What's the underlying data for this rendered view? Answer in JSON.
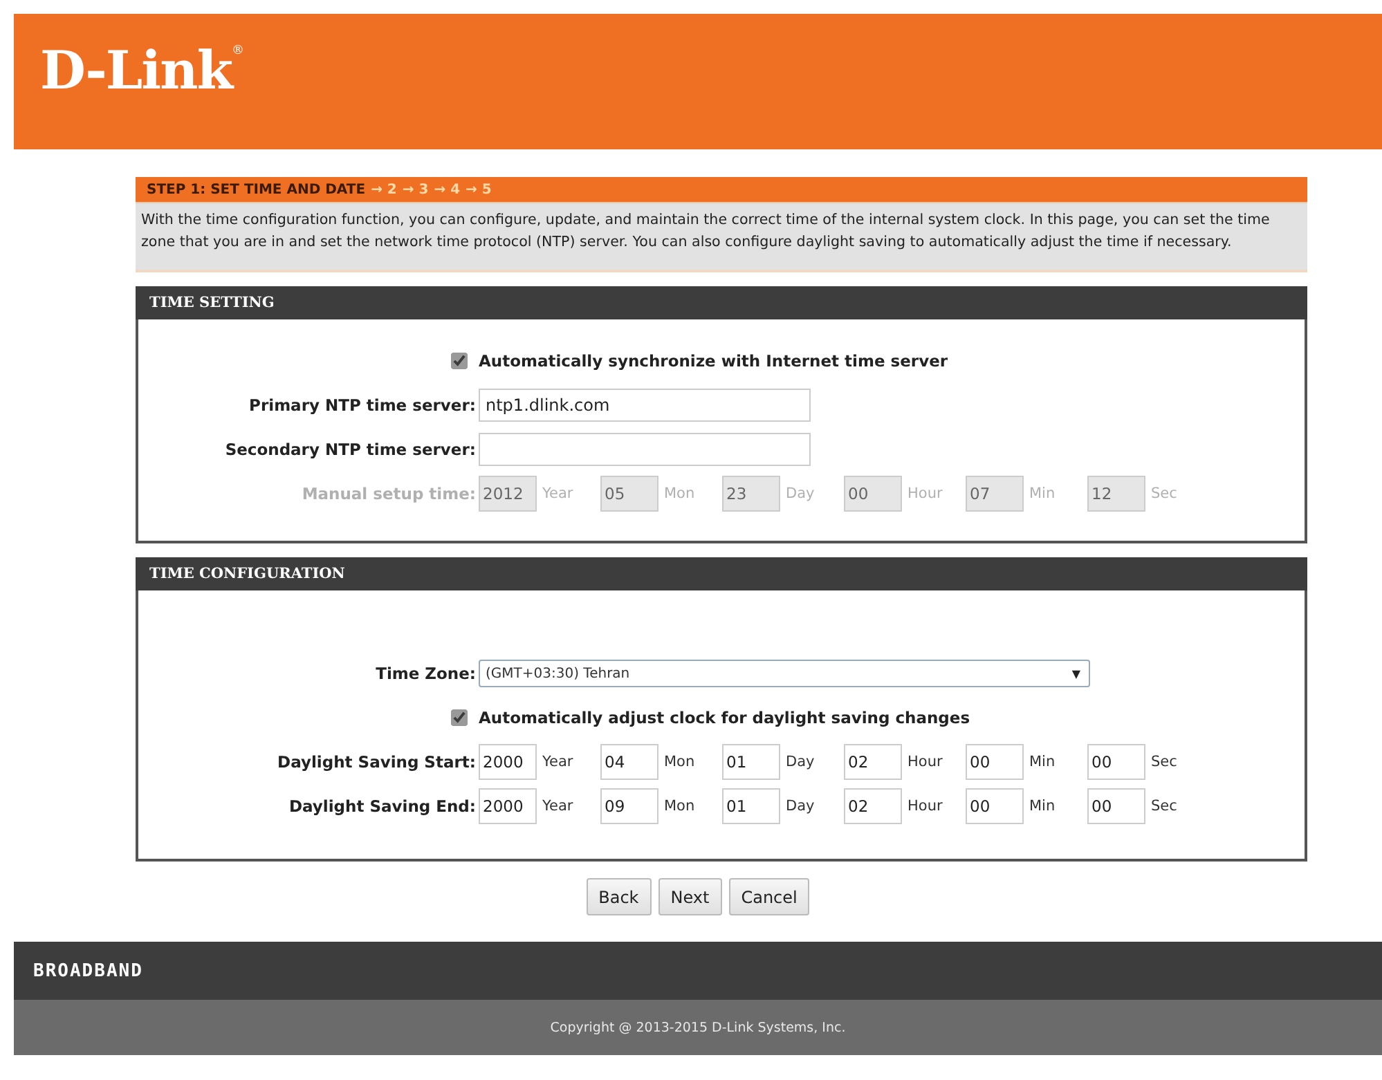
{
  "header": {
    "logo": "D-Link$^{®}$"
  },
  "wizard": {
    "title": "STEP 1: SET TIME AND DATE",
    "steps": [
      {
        "arrow": "→",
        "label": "2"
      },
      {
        "arrow": "→",
        "label": "3"
      },
      {
        "arrow": "→",
        "label": "4"
      },
      {
        "arrow": "→",
        "label": "5"
      }
    ],
    "description": "With the time configuration function, you can configure, update, and maintain the correct time of the internal system clock. In this page, you can set the time zone that you are in and set the network time protocol (NTP) server. You can also configure daylight saving to automatically adjust the time if necessary."
  },
  "sections": [
    {
      "title": "TIME SETTING",
      "rows": [
        {
          "kind": "checkbox",
          "label": "Automatically synchronize with Internet time server",
          "checked": true
        },
        {
          "kind": "text",
          "label": "Primary NTP time server:",
          "value": "ntp1.dlink.com"
        },
        {
          "kind": "text",
          "label": "Secondary NTP time server:"
        },
        {
          "kind": "datetime",
          "label": "Manual setup time:",
          "disabled": true,
          "parts": [
            {
              "value": "2012",
              "unit": "Year"
            },
            {
              "value": "05",
              "unit": "Mon"
            },
            {
              "value": "23",
              "unit": "Day"
            },
            {
              "value": "00",
              "unit": "Hour"
            },
            {
              "value": "07",
              "unit": "Min"
            },
            {
              "value": "12",
              "unit": "Sec"
            }
          ]
        }
      ]
    },
    {
      "title": "TIME CONFIGURATION",
      "rows": [
        {
          "kind": "select",
          "label": "Time Zone:",
          "value": "(GMT+03:30) Tehran",
          "arrow": "▼"
        },
        {
          "kind": "checkbox",
          "label": "Automatically adjust clock for daylight saving changes",
          "checked": true
        },
        {
          "kind": "datetime",
          "label": "Daylight Saving Start:",
          "disabled": false,
          "parts": [
            {
              "value": "2000",
              "unit": "Year"
            },
            {
              "value": "04",
              "unit": "Mon"
            },
            {
              "value": "01",
              "unit": "Day"
            },
            {
              "value": "02",
              "unit": "Hour"
            },
            {
              "value": "00",
              "unit": "Min"
            },
            {
              "value": "00",
              "unit": "Sec"
            }
          ]
        },
        {
          "kind": "datetime",
          "label": "Daylight Saving End:",
          "disabled": false,
          "parts": [
            {
              "value": "2000",
              "unit": "Year"
            },
            {
              "value": "09",
              "unit": "Mon"
            },
            {
              "value": "01",
              "unit": "Day"
            },
            {
              "value": "02",
              "unit": "Hour"
            },
            {
              "value": "00",
              "unit": "Min"
            },
            {
              "value": "00",
              "unit": "Sec"
            }
          ]
        }
      ]
    }
  ],
  "buttons": [
    "Back",
    "Next",
    "Cancel"
  ],
  "footer": {
    "brand": "BROADBAND",
    "copyright": "Copyright @ 2013-2015 D-Link Systems, Inc."
  }
}
